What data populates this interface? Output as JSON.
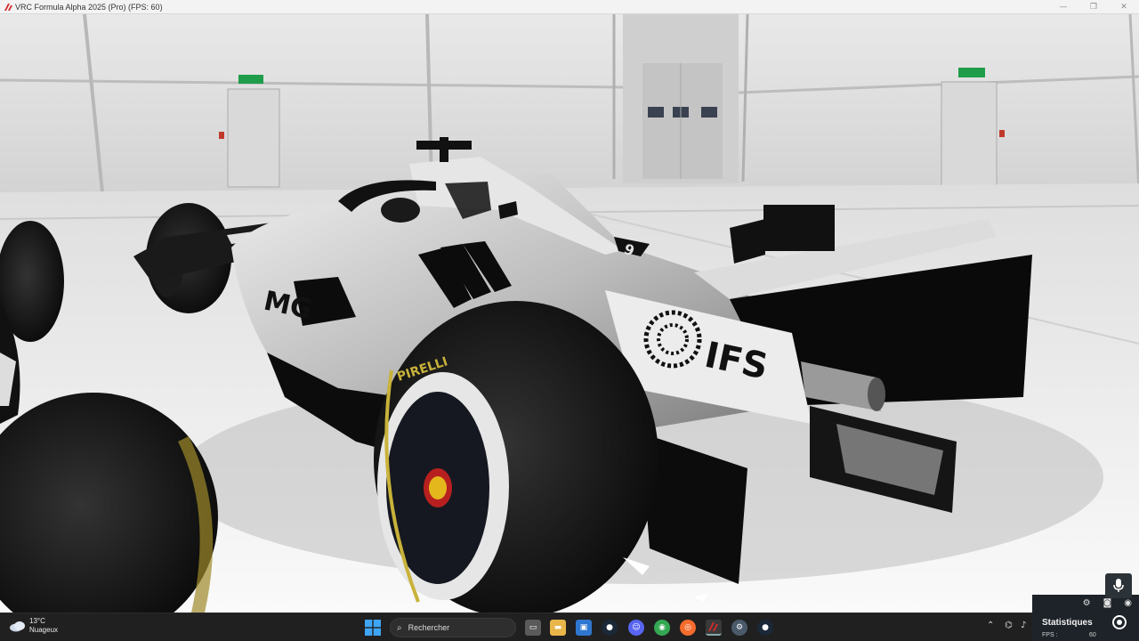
{
  "window": {
    "title": "VRC Formula Alpha 2025 (Pro) (FPS: 60)",
    "controls": {
      "minimize": "—",
      "restore": "❐",
      "close": "✕"
    }
  },
  "scene": {
    "livery": {
      "sponsor_main": "IFS",
      "sidepod_text": "MG",
      "car_number": "9"
    },
    "tire_brand": "PIRELLI"
  },
  "stats": {
    "title": "Statistiques",
    "fps_label": "FPS :",
    "fps_value": "60"
  },
  "taskbar": {
    "weather": {
      "temperature": "13°C",
      "condition": "Nuageux"
    },
    "search": {
      "placeholder": "Rechercher"
    },
    "apps": [
      {
        "name": "task-view",
        "color": "#5a5a5a"
      },
      {
        "name": "file-explorer",
        "color": "#e9b64a"
      },
      {
        "name": "store",
        "color": "#2e77d0"
      },
      {
        "name": "steam",
        "color": "#1b2838"
      },
      {
        "name": "discord",
        "color": "#5865f2"
      },
      {
        "name": "chrome",
        "color": "#34a853"
      },
      {
        "name": "origin",
        "color": "#f56c2d"
      },
      {
        "name": "game-app",
        "color": "#c8102e"
      },
      {
        "name": "settings",
        "color": "#4a5a6a"
      },
      {
        "name": "steam-2",
        "color": "#1b2838"
      }
    ]
  },
  "colors": {
    "titlebar_bg": "#f3f3f3",
    "taskbar_bg": "#202020",
    "stats_bg": "#1d2329",
    "hangar_wall": "#dcdcdc",
    "floor": "#f5f5f5",
    "car_body": "#cfcfcf",
    "car_black": "#0c0c0c",
    "exit_sign": "#1f9d4a"
  }
}
